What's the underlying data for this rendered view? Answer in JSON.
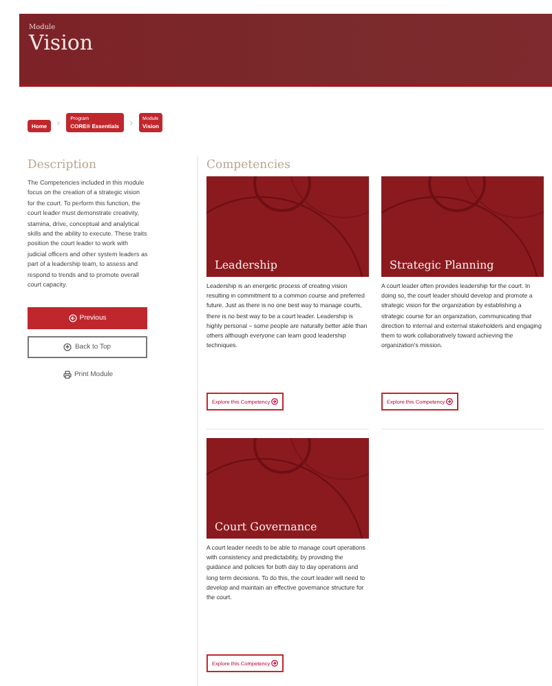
{
  "header": {
    "eyebrow": "Module",
    "title": "Vision"
  },
  "breadcrumbs": [
    {
      "label": "Home"
    },
    {
      "eyebrow": "Program",
      "label": "CORE® Essentials"
    },
    {
      "eyebrow": "Module",
      "label": "Vision"
    }
  ],
  "sidebar": {
    "heading": "Description",
    "text": "The Competencies included in this module focus on the creation of a strategic vision for the court. To perform this function, the court leader must demonstrate creativity, stamina, drive, conceptual and analytical skills and the ability to execute. These traits position the court leader to work with judicial officers and other system leaders as part of a leadership team, to assess and respond to trends and to promote overall court capacity.",
    "buttons": [
      {
        "kind": "primary",
        "label": "Previous"
      },
      {
        "kind": "outline",
        "label": "Back to Top"
      },
      {
        "kind": "link",
        "label": "Print Module"
      }
    ]
  },
  "competencies": {
    "heading": "Competencies",
    "cards": [
      {
        "title": "Leadership",
        "text": "Leadership is an energetic process of creating vision resulting in commitment to a common course and preferred future. Just as there is no one best way to manage courts, there is no best way to be a court leader. Leadership is highly personal – some people are naturally better able than others although everyone can learn good leadership techniques.",
        "button": "Explore this Competency"
      },
      {
        "title": "Strategic Planning",
        "text": "A court leader often provides leadership for the court. In doing so, the court leader should develop and promote a strategic vision for the organization by establishing a strategic course for an organization, communicating that direction to internal and external stakeholders and engaging them to work collaboratively toward achieving the organization's mission.",
        "button": "Explore this Competency"
      },
      {
        "title": "Court Governance",
        "text": "A court leader needs to be able to manage court operations with consistency and predictability, by providing the guidance and policies for both day to day operations and long term decisions. To do this, the court leader will need to develop and maintain an effective governance structure for the court.",
        "button": "Explore this Competency"
      }
    ]
  }
}
